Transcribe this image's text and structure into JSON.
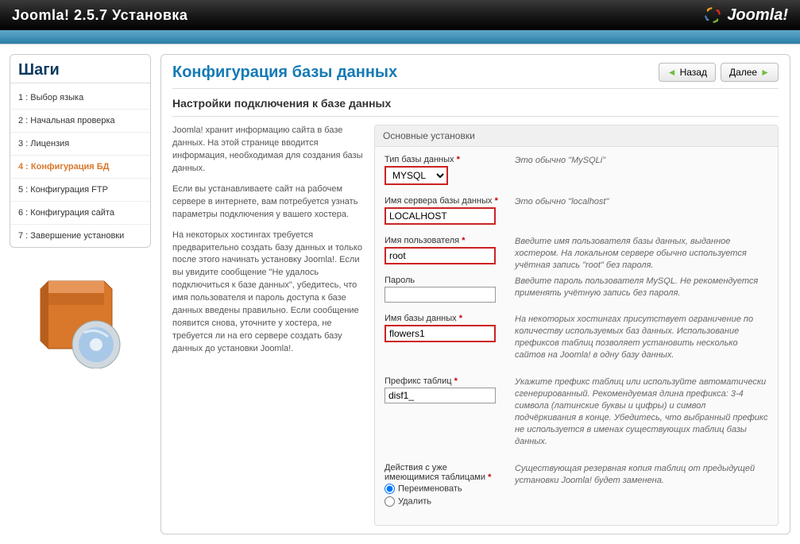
{
  "header": {
    "title": "Joomla! 2.5.7 Установка",
    "logo_text": "Joomla!"
  },
  "sidebar": {
    "steps_title": "Шаги",
    "steps": [
      {
        "label": "1 : Выбор языка"
      },
      {
        "label": "2 : Начальная проверка"
      },
      {
        "label": "3 : Лицензия"
      },
      {
        "label": "4 : Конфигурация БД",
        "active": true
      },
      {
        "label": "5 : Конфигурация FTP"
      },
      {
        "label": "6 : Конфигурация сайта"
      },
      {
        "label": "7 : Завершение установки"
      }
    ]
  },
  "main": {
    "title": "Конфигурация базы данных",
    "btn_back": "Назад",
    "btn_next": "Далее",
    "subtitle": "Настройки подключения к базе данных",
    "intro": {
      "p1": "Joomla! хранит информацию сайта в базе данных. На этой странице вводится информация, необходимая для создания базы данных.",
      "p2": "Если вы устанавливаете сайт на рабочем сервере в интернете, вам потребуется узнать параметры подключения у вашего хостера.",
      "p3": "На некоторых хостингах требуется предварительно создать базу данных и только после этого начинать установку Joomla!. Если вы увидите сообщение \"Не удалось подключиться к базе данных\", убедитесь, что имя пользователя и пароль доступа к базе данных введены правильно. Если сообщение появится снова, уточните у хостера, не требуется ли на его сервере создать базу данных до установки Joomla!."
    },
    "fieldset_title": "Основные установки",
    "fields": {
      "dbtype": {
        "label": "Тип базы данных",
        "value": "MYSQL",
        "desc": "Это обычно \"MySQLi\""
      },
      "host": {
        "label": "Имя сервера базы данных",
        "value": "LOCALHOST",
        "desc": "Это обычно \"localhost\""
      },
      "user": {
        "label": "Имя пользователя",
        "value": "root",
        "desc": "Введите имя пользователя базы данных, выданное хостером. На локальном сервере обычно используется учётная запись \"root\" без пароля."
      },
      "pass": {
        "label": "Пароль",
        "value": "",
        "desc": "Введите пароль пользователя MySQL. Не рекомендуется применять учётную запись без пароля."
      },
      "dbname": {
        "label": "Имя базы данных",
        "value": "flowers1",
        "desc": "На некоторых хостингах присутствует ограничение по количеству используемых баз данных. Использование префиксов таблиц позволяет установить несколько сайтов на Joomla! в одну базу данных."
      },
      "prefix": {
        "label": "Префикс таблиц",
        "value": "disf1_",
        "desc": "Укажите префикс таблиц или используйте автоматически сгенерированный. Рекомендуемая длина префикса: 3-4 символа (латинские буквы и цифры) и символ подчёркивания в конце. Убедитесь, что выбранный префикс не используется в именах существующих таблиц базы данных."
      },
      "action": {
        "label": "Действия с уже имеющимися таблицами",
        "opt_rename": "Переименовать",
        "opt_delete": "Удалить",
        "desc": "Существующая резервная копия таблиц от предыдущей установки Joomla! будет заменена."
      }
    }
  }
}
